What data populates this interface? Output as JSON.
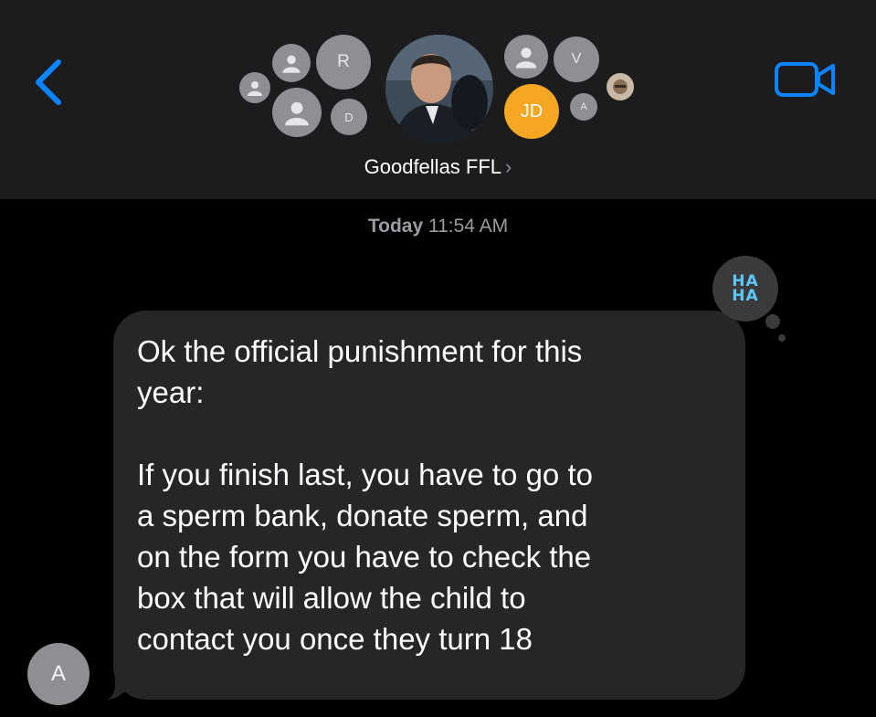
{
  "header": {
    "group_name": "Goodfellas FFL",
    "chevron": "›",
    "avatars": [
      {
        "initial": "R"
      },
      {
        "initial": "V"
      },
      {
        "initial": "D"
      },
      {
        "initial": "JD"
      },
      {
        "initial": "A"
      }
    ],
    "icons": {
      "back": "chevron-left-icon",
      "video": "video-camera-icon",
      "person": "person-icon"
    },
    "accent_color": "#0a84ff"
  },
  "thread": {
    "timestamp_day": "Today",
    "timestamp_time": "11:54 AM"
  },
  "message": {
    "sender_initial": "A",
    "text": "Ok the official punishment for this\nyear:\n\nIf you finish last, you have to go to\na sperm bank, donate sperm, and\non the form you have to check the\nbox that will allow the child to\ncontact you once they turn 18",
    "tapback": {
      "line1": "HA",
      "line2": "HA",
      "type": "haha"
    }
  }
}
